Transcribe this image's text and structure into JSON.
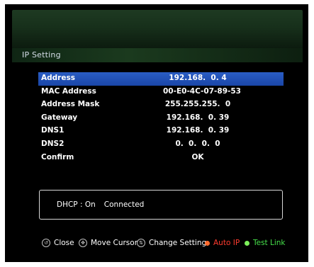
{
  "screen": {
    "title": "IP Setting"
  },
  "settings": {
    "rows": [
      {
        "label": "Address",
        "value": "192.168.  0. 4",
        "selected": true
      },
      {
        "label": "MAC Address",
        "value": "00-E0-4C-07-89-53",
        "selected": false
      },
      {
        "label": "Address Mask",
        "value": "255.255.255.  0",
        "selected": false
      },
      {
        "label": "Gateway",
        "value": "192.168.  0. 39",
        "selected": false
      },
      {
        "label": "DNS1",
        "value": "192.168.  0. 39",
        "selected": false
      },
      {
        "label": "DNS2",
        "value": "0.  0.  0.  0",
        "selected": false
      },
      {
        "label": "Confirm",
        "value": "OK",
        "selected": false
      }
    ]
  },
  "status": {
    "dhcp_label": "DHCP : On",
    "connection": "Connected"
  },
  "footer": {
    "close": {
      "icon": "close-key-icon",
      "label": "Close"
    },
    "move": {
      "icon": "arrow-keys-icon",
      "label": "Move Cursor"
    },
    "change": {
      "icon": "change-key-icon",
      "label": "Change Setting"
    },
    "auto_ip": {
      "icon": "red-button-icon",
      "label": "Auto IP",
      "color": "#ff3b2f"
    },
    "test_link": {
      "icon": "green-button-icon",
      "label": "Test Link",
      "color": "#46e04a"
    }
  }
}
